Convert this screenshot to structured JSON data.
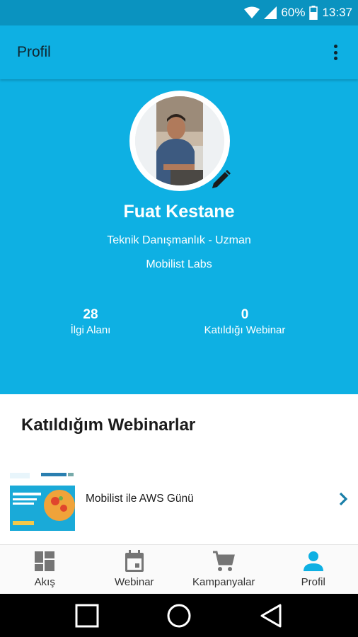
{
  "status_bar": {
    "battery": "60%",
    "time": "13:37"
  },
  "app_bar": {
    "title": "Profil"
  },
  "profile": {
    "name": "Fuat Kestane",
    "role": "Teknik Danışmanlık - Uzman",
    "company": "Mobilist Labs",
    "stats": [
      {
        "value": "28",
        "label": "İlgi Alanı"
      },
      {
        "value": "0",
        "label": "Katıldığı Webinar"
      }
    ]
  },
  "webinars": {
    "title": "Katıldığım Webinarlar",
    "items": [
      {
        "title": "Mobilist ile AWS Günü"
      }
    ]
  },
  "bottom_nav": {
    "items": [
      {
        "label": "Akış",
        "icon": "dashboard-icon"
      },
      {
        "label": "Webinar",
        "icon": "calendar-icon"
      },
      {
        "label": "Kampanyalar",
        "icon": "cart-icon"
      },
      {
        "label": "Profil",
        "icon": "person-icon",
        "active": true
      }
    ]
  },
  "colors": {
    "primary": "#0eb0e3",
    "status_bar": "#0a93c0",
    "nav_icon": "#757575",
    "nav_active": "#0eb0e3",
    "chevron": "#1a7fa8"
  }
}
